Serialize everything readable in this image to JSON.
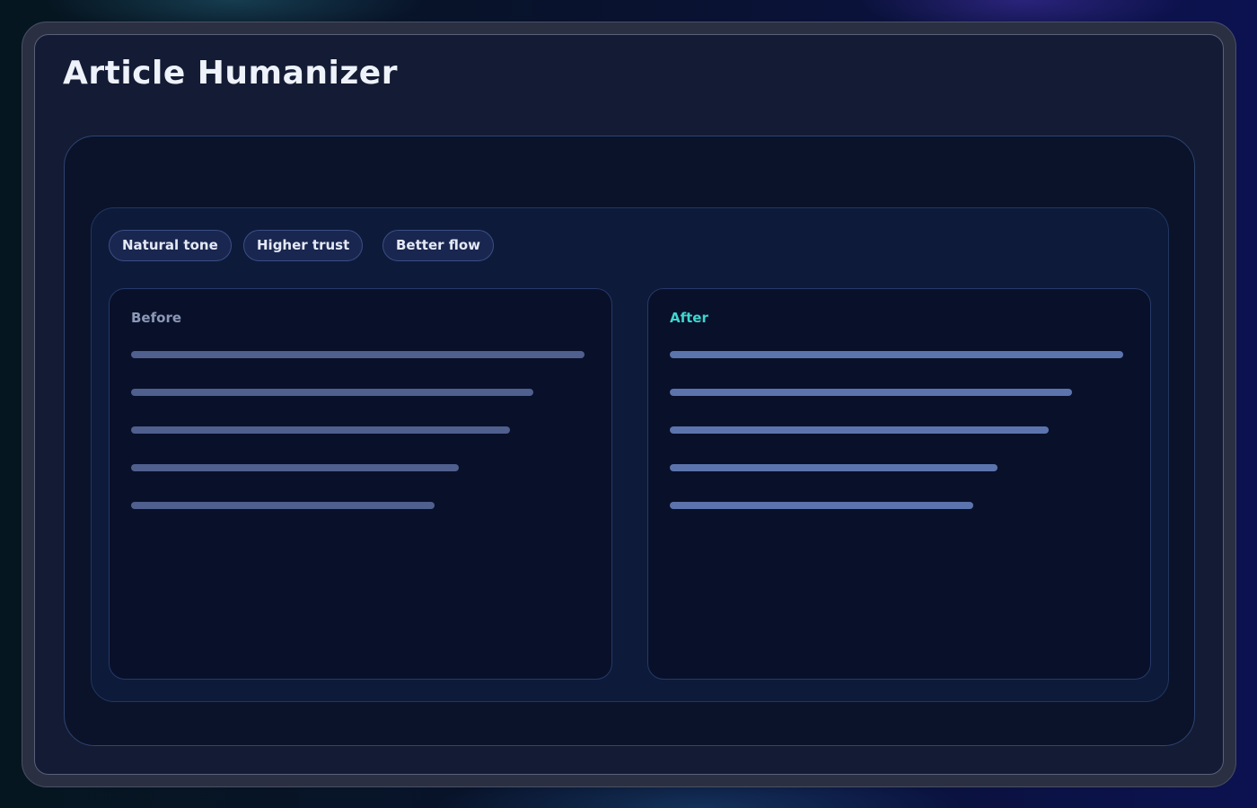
{
  "app": {
    "title": "Article Humanizer"
  },
  "chips": [
    {
      "label": "Natural tone"
    },
    {
      "label": "Higher trust"
    },
    {
      "label": "Better flow"
    }
  ],
  "panels": {
    "before": {
      "label": "Before",
      "label_color": "#8c98b8",
      "line_fractions": [
        1.0,
        0.887,
        0.836,
        0.723,
        0.669
      ]
    },
    "after": {
      "label": "After",
      "label_color": "#3ed6cf",
      "line_fractions": [
        1.0,
        0.887,
        0.836,
        0.723,
        0.669
      ]
    }
  }
}
